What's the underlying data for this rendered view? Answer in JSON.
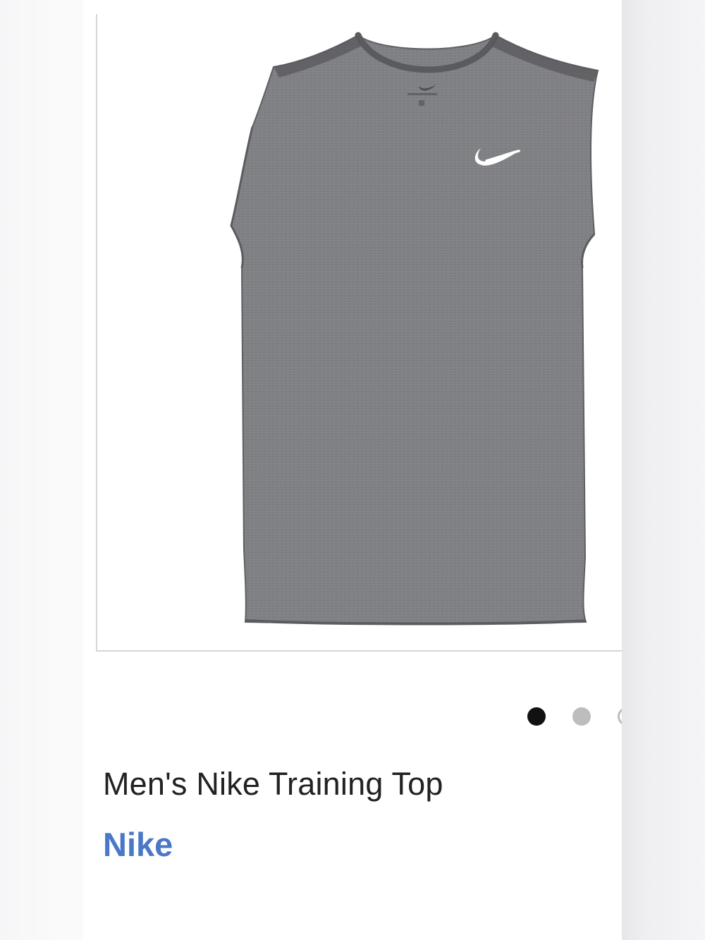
{
  "product": {
    "title": "Men's Nike Training Top",
    "brand": "Nike",
    "image_icon": "sleeveless-tank-top-image",
    "carousel": {
      "count_visible": 3,
      "active_index": 0
    }
  },
  "colors": {
    "brand_link": "#4a78c7",
    "title_text": "#222222",
    "dot_active": "#111111",
    "dot_inactive": "#bdbdbd",
    "garment": "#7f8083"
  }
}
